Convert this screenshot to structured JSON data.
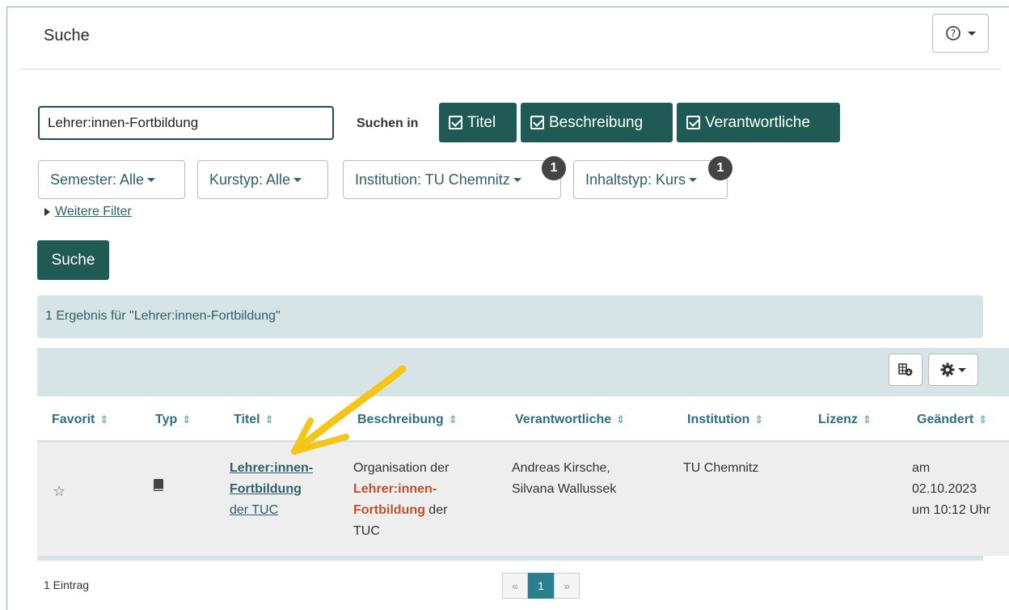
{
  "header": {
    "title": "Suche",
    "help_icon": "question-circle"
  },
  "search": {
    "value": "Lehrer:innen-Fortbildung",
    "suchen_in_label": "Suchen in",
    "scopes": [
      {
        "label": "Titel",
        "checked": true
      },
      {
        "label": "Beschreibung",
        "checked": true
      },
      {
        "label": "Verantwortliche",
        "checked": true
      }
    ]
  },
  "filters": [
    {
      "label": "Semester: Alle"
    },
    {
      "label": "Kurstyp: Alle"
    },
    {
      "label": "Institution: TU Chemnitz",
      "badge": "1"
    },
    {
      "label": "Inhaltstyp: Kurs",
      "badge": "1"
    }
  ],
  "more_filters": "Weitere Filter",
  "search_button": "Suche",
  "result_summary": "1 Ergebnis für \"Lehrer:innen-Fortbildung\"",
  "table": {
    "columns": [
      "Favorit",
      "Typ",
      "Titel",
      "Beschreibung",
      "Verantwortliche",
      "Institution",
      "Lizenz",
      "Geändert"
    ],
    "rows": [
      {
        "favorite": "☆",
        "type_icon": "book-icon",
        "title_hl_1": "Lehrer:innen-",
        "title_hl_2": "Fortbildung",
        "title_rest": "der TUC",
        "desc_1": "Organisation der",
        "desc_hl_1": "Lehrer:innen-",
        "desc_hl_2": "Fortbildung",
        "desc_2": " der",
        "desc_3": "TUC",
        "responsible_1": "Andreas Kirsche,",
        "responsible_2": "Silvana Wallussek",
        "institution": "TU Chemnitz",
        "license": "",
        "changed_1": "am",
        "changed_2": "02.10.2023",
        "changed_3": "um 10:12 Uhr"
      }
    ]
  },
  "footer": {
    "count": "1 Eintrag",
    "pager": {
      "prev": "«",
      "current": "1",
      "next": "»"
    }
  },
  "colors": {
    "accent": "#1f5a55",
    "highlight": "#c0502b",
    "annotation": "#f5c518"
  }
}
